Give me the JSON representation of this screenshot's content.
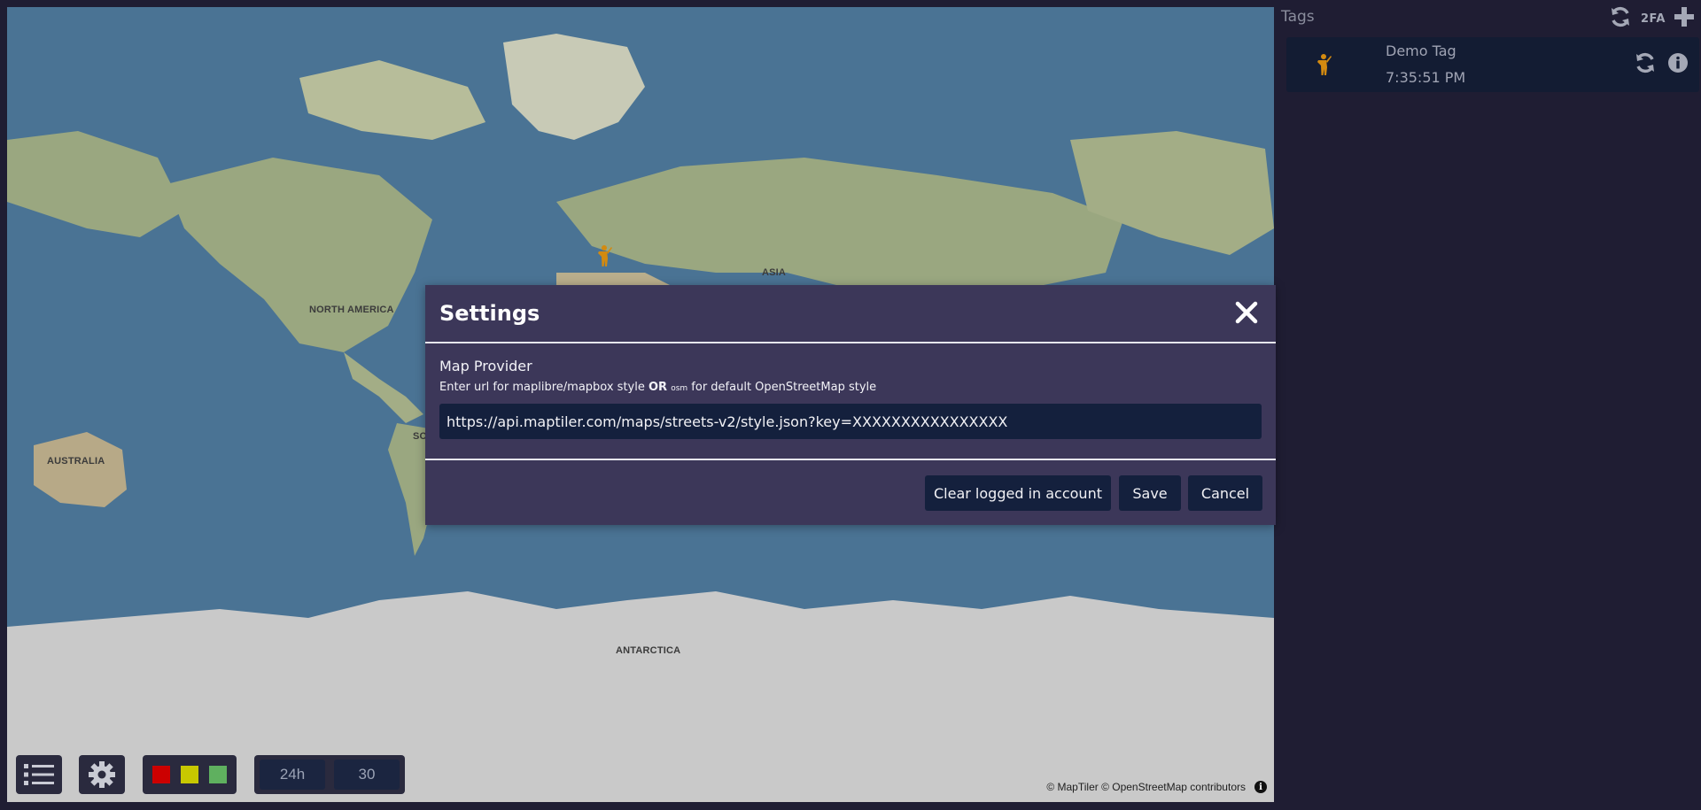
{
  "map": {
    "labels": {
      "north_america": "NORTH AMERICA",
      "asia": "ASIA",
      "australia": "AUSTRALIA",
      "south_america_partial": "SO",
      "antarctica": "ANTARCTICA"
    },
    "attribution": "© MapTiler © OpenStreetMap contributors",
    "attribution_info_icon": "info-icon",
    "marker_icon": "person-waving-icon",
    "colors": {
      "ocean": "#4a7394",
      "land": "#9aa780",
      "ice": "#c8c8c8"
    }
  },
  "toolbar": {
    "list_icon": "list-icon",
    "settings_icon": "gear-icon",
    "color_filters": [
      "#cc0000",
      "#c8c800",
      "#5fb05f"
    ],
    "range_hours": "24h",
    "range_count": "30"
  },
  "sidebar": {
    "title": "Tags",
    "refresh_icon": "refresh-icon",
    "twofa_label": "2FA",
    "add_icon": "plus-icon",
    "tags": [
      {
        "name": "Demo Tag",
        "time": "7:35:51 PM",
        "icon": "person-waving-icon"
      }
    ]
  },
  "modal": {
    "title": "Settings",
    "close_icon": "close-icon",
    "field_label": "Map Provider",
    "hint_prefix": "Enter url for maplibre/mapbox style ",
    "hint_or": "OR",
    "hint_osm": "osm",
    "hint_suffix": " for default OpenStreetMap style",
    "url_value": "https://api.maptiler.com/maps/streets-v2/style.json?key=XXXXXXXXXXXXXXXX",
    "buttons": {
      "clear": "Clear logged in account",
      "save": "Save",
      "cancel": "Cancel"
    }
  }
}
